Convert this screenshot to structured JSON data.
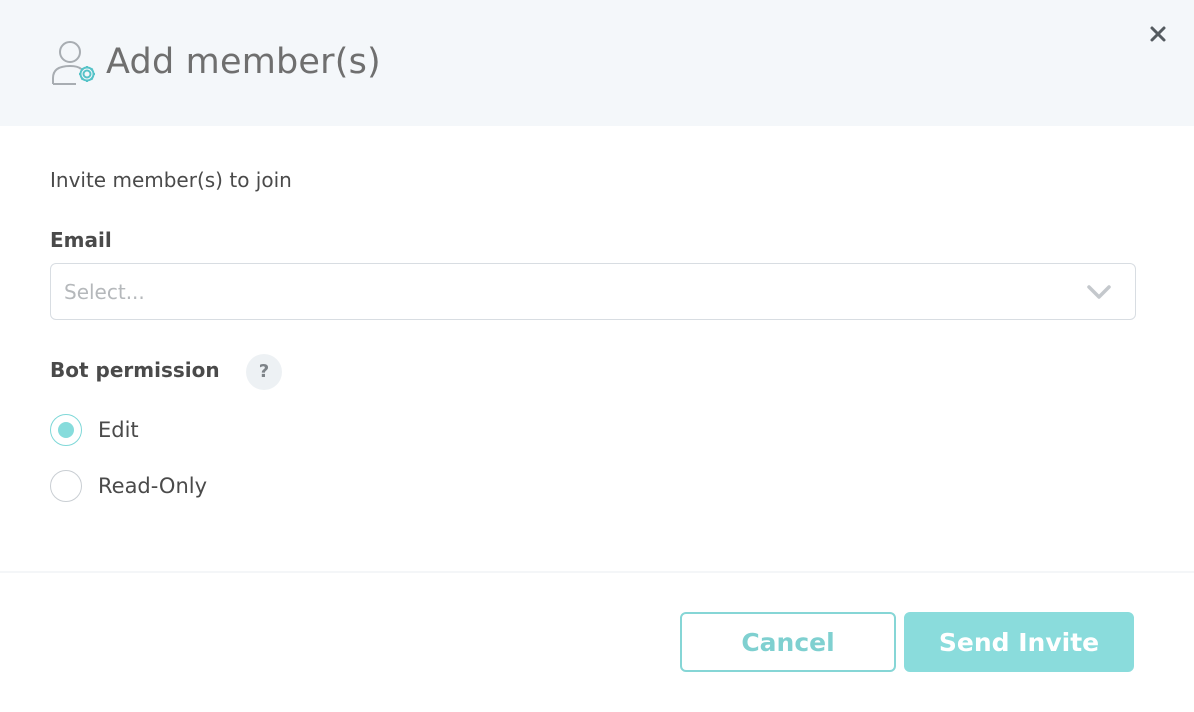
{
  "dialog": {
    "title": "Add member(s)",
    "close_icon": "close-icon",
    "header_icon": "user-settings-icon"
  },
  "form": {
    "subtitle": "Invite member(s) to join",
    "email": {
      "label": "Email",
      "placeholder": "Select..."
    },
    "permission": {
      "label": "Bot permission",
      "help": "?",
      "options": [
        {
          "label": "Edit",
          "checked": true
        },
        {
          "label": "Read-Only",
          "checked": false
        }
      ]
    }
  },
  "footer": {
    "cancel_label": "Cancel",
    "send_label": "Send Invite"
  },
  "colors": {
    "accent": "#86dcdc",
    "header_bg": "#f4f7fa",
    "text": "#4a4a4a"
  }
}
